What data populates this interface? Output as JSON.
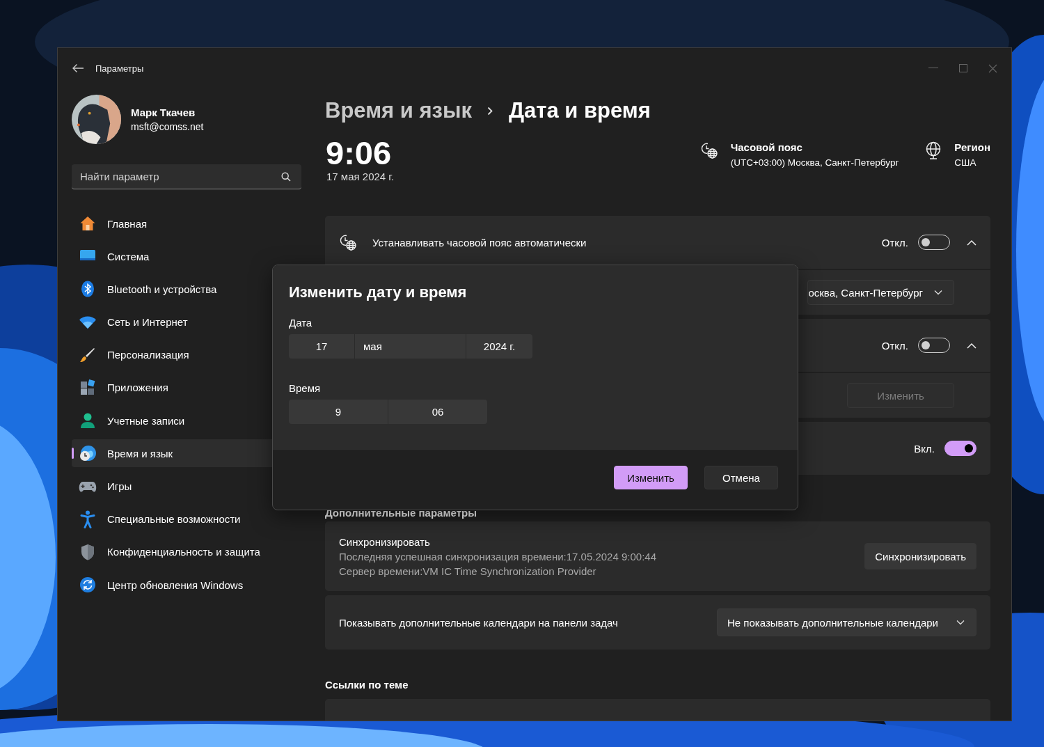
{
  "window": {
    "title": "Параметры"
  },
  "user": {
    "name": "Марк Ткачев",
    "email": "msft@comss.net"
  },
  "search": {
    "placeholder": "Найти параметр"
  },
  "sidebar": {
    "items": [
      {
        "label": "Главная",
        "kind": "home",
        "selected": false
      },
      {
        "label": "Система",
        "kind": "system",
        "selected": false
      },
      {
        "label": "Bluetooth и устройства",
        "kind": "bluetooth",
        "selected": false
      },
      {
        "label": "Сеть и Интернет",
        "kind": "network",
        "selected": false
      },
      {
        "label": "Персонализация",
        "kind": "brush",
        "selected": false
      },
      {
        "label": "Приложения",
        "kind": "apps",
        "selected": false
      },
      {
        "label": "Учетные записи",
        "kind": "person",
        "selected": false
      },
      {
        "label": "Время и язык",
        "kind": "time",
        "selected": true
      },
      {
        "label": "Игры",
        "kind": "games",
        "selected": false
      },
      {
        "label": "Специальные возможности",
        "kind": "access",
        "selected": false
      },
      {
        "label": "Конфиденциальность и защита",
        "kind": "shield",
        "selected": false
      },
      {
        "label": "Центр обновления Windows",
        "kind": "update",
        "selected": false
      }
    ]
  },
  "breadcrumb": {
    "parent": "Время и язык",
    "current": "Дата и время"
  },
  "clock": {
    "time": "9:06",
    "date": "17 мая 2024 г."
  },
  "timezone": {
    "label": "Часовой пояс",
    "value": "(UTC+03:00) Москва, Санкт-Петербург"
  },
  "region": {
    "label": "Регион",
    "value": "США"
  },
  "settings": [
    {
      "kind": "expander",
      "label": "Устанавливать часовой пояс автоматически",
      "state_text": "Откл.",
      "on": false,
      "expanded": true,
      "sub": {
        "kind": "dropdown",
        "value": "осква, Санкт-Петербург"
      }
    },
    {
      "kind": "expander",
      "state_text": "Откл.",
      "on": false,
      "expanded": true,
      "sub": {
        "kind": "button",
        "label": "Изменить",
        "disabled": true
      }
    },
    {
      "kind": "toggle",
      "state_text": "Вкл.",
      "on": true
    }
  ],
  "extra": {
    "heading": "Дополнительные параметры",
    "sync": {
      "title": "Синхронизировать",
      "lines": [
        "Последняя успешная синхронизация времени:17.05.2024 9:00:44",
        "Сервер времени:VM IC Time Synchronization Provider"
      ],
      "button": "Синхронизировать"
    },
    "calendars": {
      "label": "Показывать дополнительные календари на панели задач",
      "value": "Не показывать дополнительные календари"
    }
  },
  "related": {
    "heading": "Ссылки по теме"
  },
  "dialog": {
    "title": "Изменить дату и время",
    "date_label": "Дата",
    "date_parts": [
      "17",
      "мая",
      "2024 г."
    ],
    "time_label": "Время",
    "time_parts": [
      "9",
      "06"
    ],
    "buttons": [
      {
        "label": "Изменить",
        "primary": true
      },
      {
        "label": "Отмена",
        "primary": false
      }
    ]
  }
}
